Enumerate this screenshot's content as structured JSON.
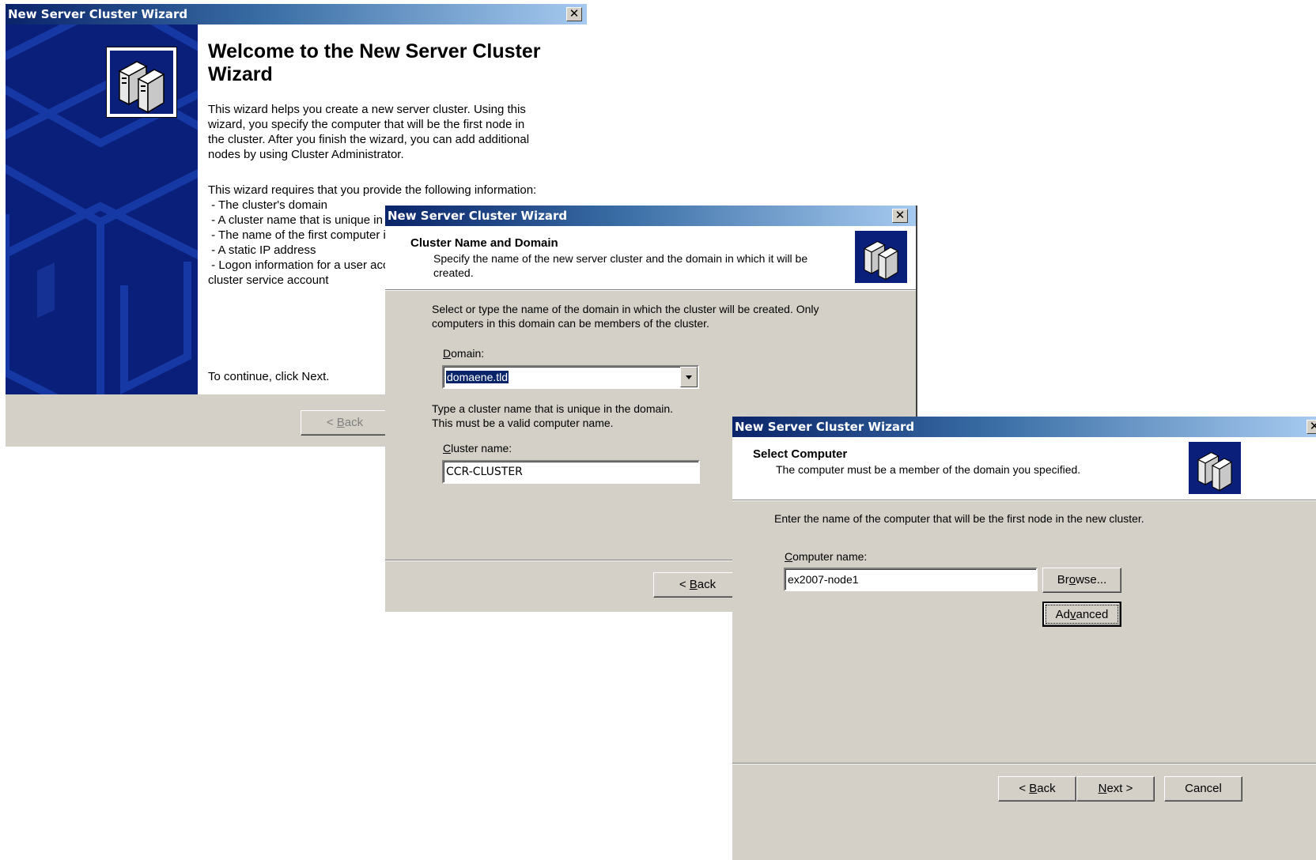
{
  "windows": {
    "welcome": {
      "title": "New Server Cluster Wizard",
      "heading": "Welcome to the New Server Cluster Wizard",
      "intro": [
        "This wizard helps you create a new server cluster. Using this",
        "wizard, you specify the computer that will be the first node in",
        "the cluster. After you finish the wizard, you can add additional",
        "nodes by using Cluster Administrator."
      ],
      "requires": [
        "This wizard requires that you provide the following information:",
        " - The cluster's domain",
        " - A cluster name that is unique in the domain",
        " - The name of the first computer in the cluster",
        " - A static IP address",
        " - Logon information for a user account that will be used as the",
        "cluster service account"
      ],
      "continue_text": "To continue, click Next.",
      "back_button": {
        "pre": "< ",
        "key": "B",
        "rest": "ack"
      },
      "icon": "server-cluster-icon"
    },
    "cluster_name": {
      "title": "New Server Cluster Wizard",
      "heading": "Cluster Name and Domain",
      "subheading_lines": [
        "Specify the name of the new server cluster and the domain in which it will be",
        "created."
      ],
      "domain_instructions": [
        "Select or type the name of the domain in which the cluster will be created. Only",
        "computers in this domain can be members of the cluster."
      ],
      "domain_label": {
        "key": "D",
        "rest": "omain:"
      },
      "domain_value": "domaene.tld",
      "name_instructions": [
        "Type a cluster name that is unique in the domain.",
        "This must be a valid computer name."
      ],
      "cluster_label": {
        "key": "C",
        "rest": "luster name:"
      },
      "cluster_value": "CCR-CLUSTER",
      "back_button": {
        "pre": "< ",
        "key": "B",
        "rest": "ack"
      },
      "icon": "server-cluster-icon"
    },
    "select_computer": {
      "title": "New Server Cluster Wizard",
      "heading": "Select Computer",
      "subheading": "The computer must be a member of the domain you specified.",
      "instructions": "Enter the name of the computer that will be the first node in the new cluster.",
      "computer_label": {
        "key": "C",
        "rest": "omputer name:"
      },
      "computer_value": "ex2007-node1",
      "browse_button": {
        "pre": "Br",
        "key": "o",
        "rest": "wse..."
      },
      "advanced_button": {
        "pre": "Ad",
        "key": "v",
        "rest": "anced"
      },
      "back_button": {
        "pre": "< ",
        "key": "B",
        "rest": "ack"
      },
      "next_button": {
        "pre": "",
        "key": "N",
        "rest": "ext >"
      },
      "cancel_button": "Cancel",
      "icon": "server-cluster-icon"
    }
  },
  "colors": {
    "dialog_bg": "#d4d0c8",
    "titlebar_start": "#0a246a",
    "titlebar_end": "#a6caf0",
    "banner_bg": "#0a1f7a",
    "selection": "#0a246a"
  }
}
